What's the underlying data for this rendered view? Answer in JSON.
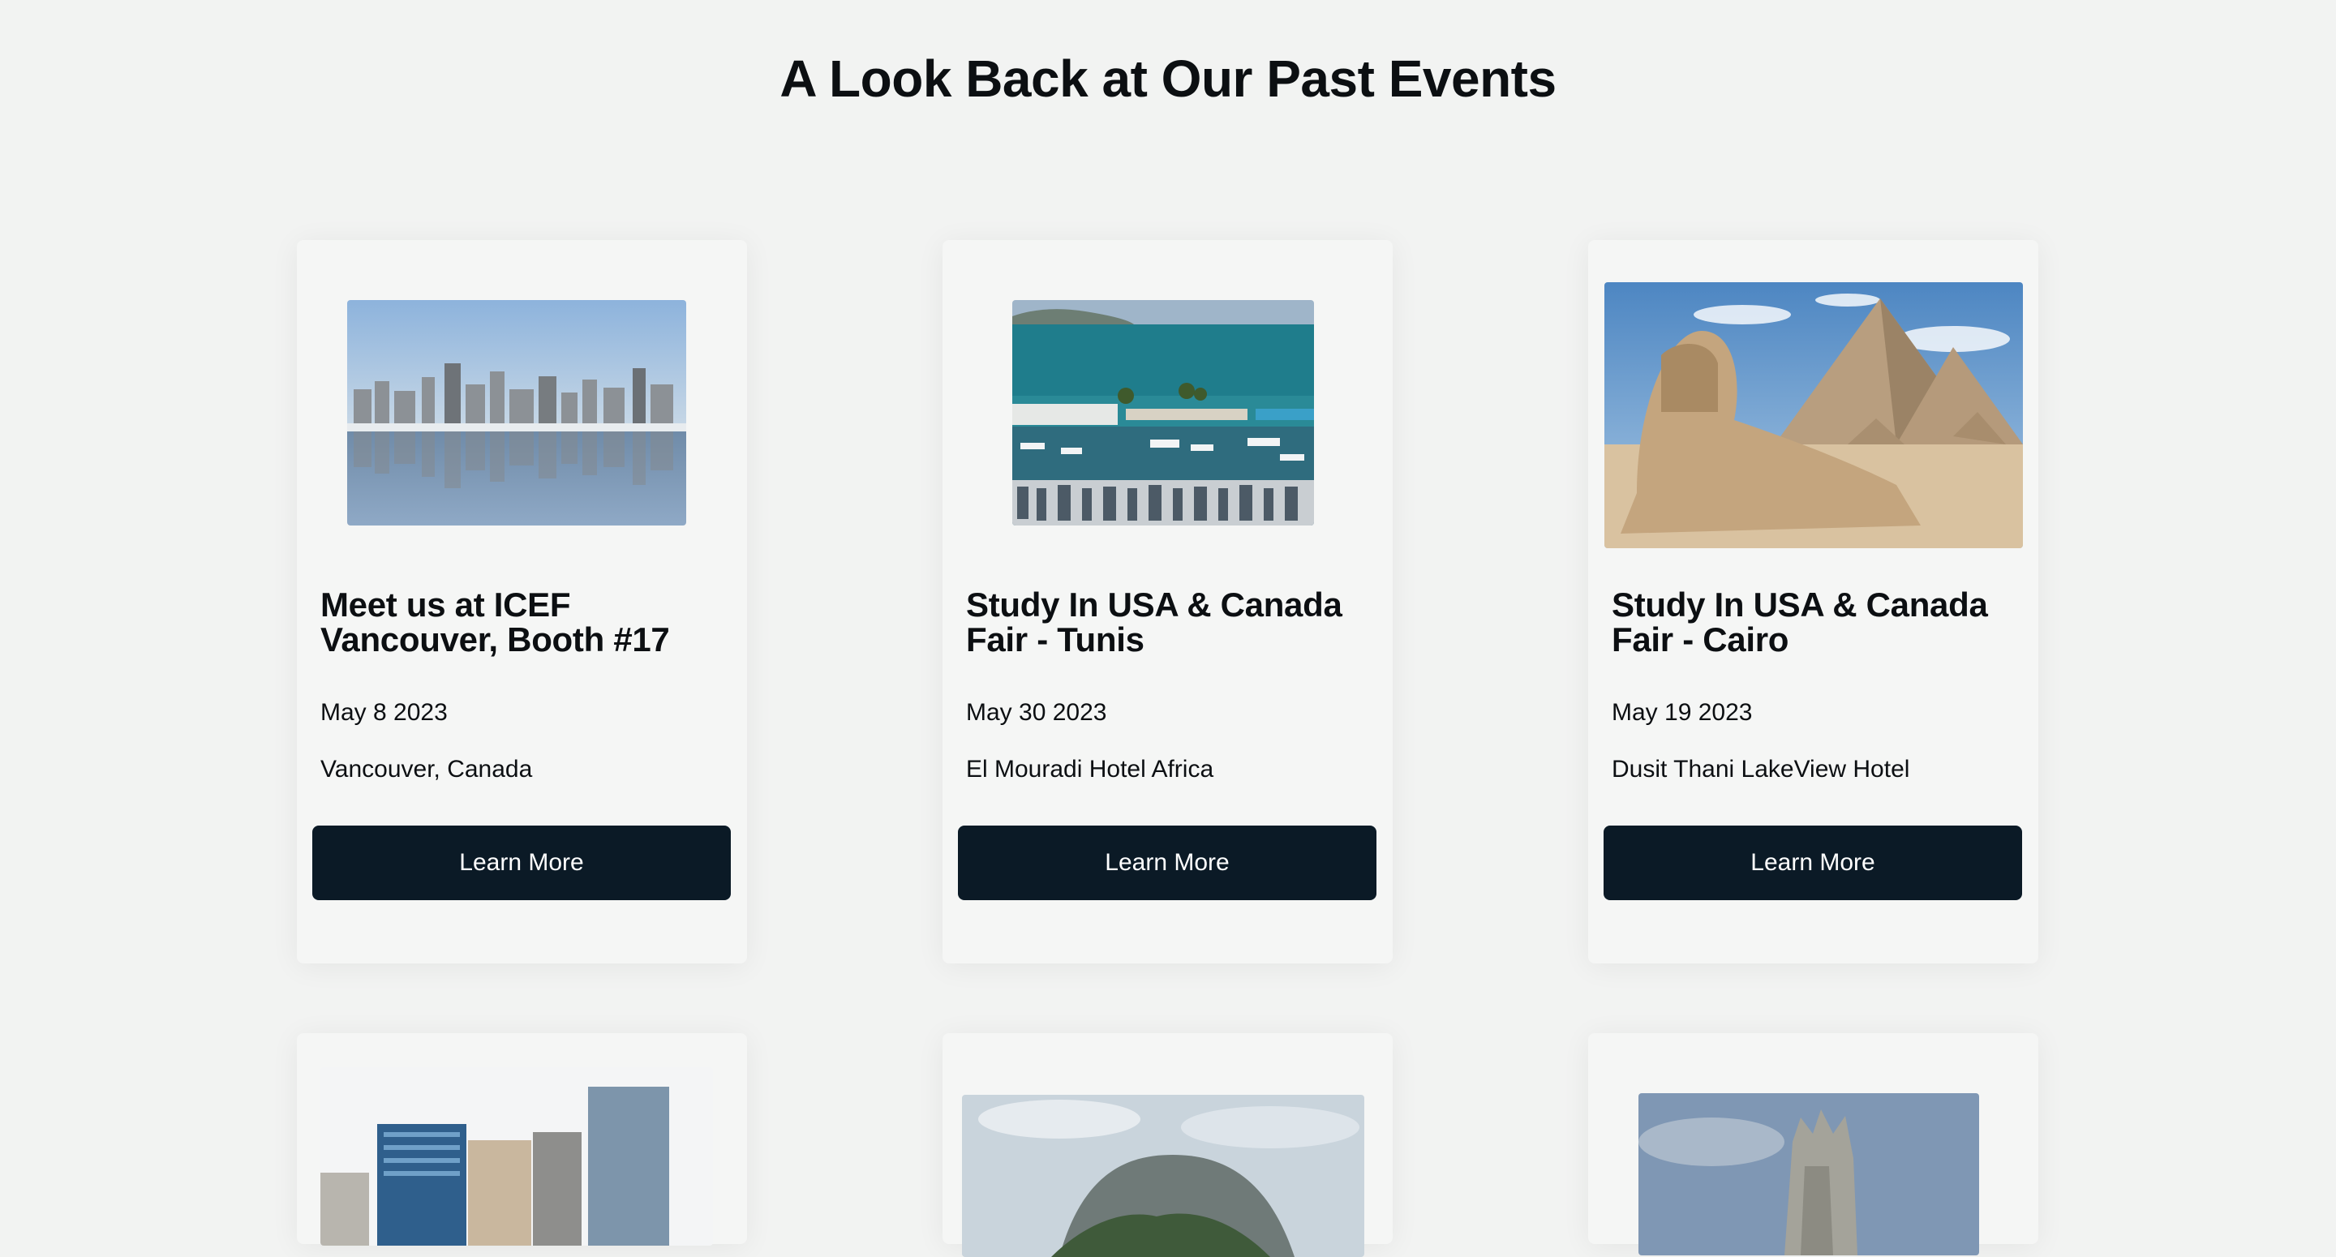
{
  "page": {
    "title": "A Look Back at Our Past Events"
  },
  "events": [
    {
      "title": "Meet us at ICEF Vancouver, Booth #17",
      "date": "May 8 2023",
      "venue": "Vancouver, Canada",
      "button": "Learn More",
      "image": "vancouver-skyline-photo"
    },
    {
      "title": "Study In USA & Canada Fair - Tunis",
      "date": "May 30 2023",
      "venue": "El Mouradi Hotel Africa",
      "button": "Learn More",
      "image": "tunis-harbor-photo"
    },
    {
      "title": "Study In USA & Canada Fair - Cairo",
      "date": "May 19 2023",
      "venue": "Dusit Thani LakeView Hotel",
      "button": "Learn More",
      "image": "pyramids-sphinx-photo"
    }
  ],
  "more_events": [
    {
      "image": "city-office-towers-photo"
    },
    {
      "image": "rock-mountain-photo"
    },
    {
      "image": "stone-monument-photo"
    }
  ],
  "colors": {
    "background": "#f2f3f2",
    "card": "#f5f6f5",
    "button": "#0b1a26",
    "button_text": "#ffffff"
  }
}
